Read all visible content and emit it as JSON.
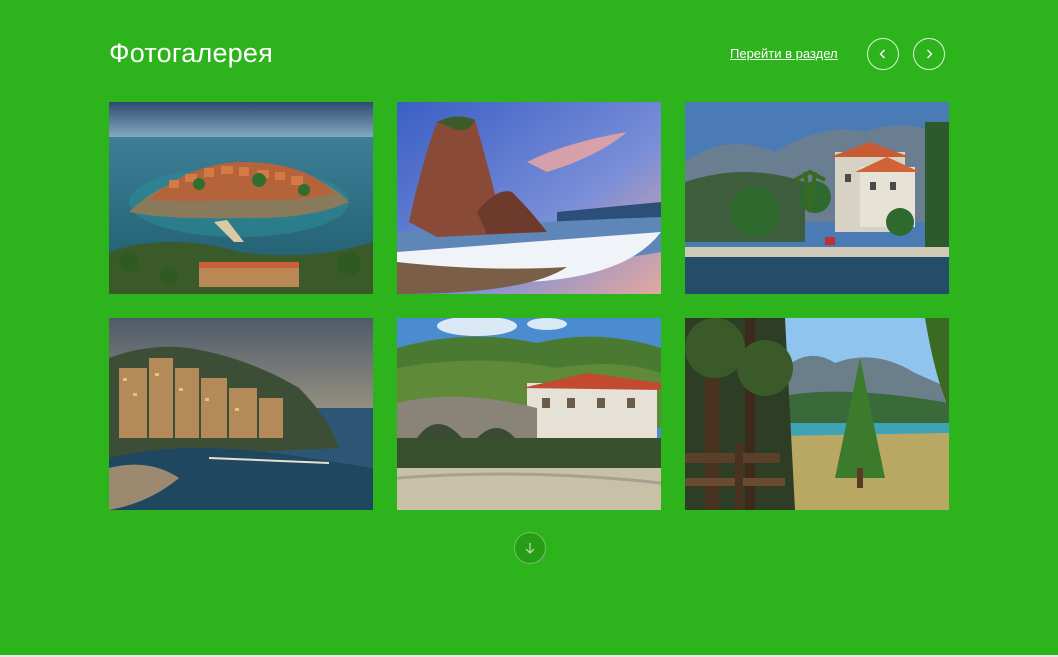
{
  "header": {
    "title": "Фотогалерея",
    "section_link": "Перейти в раздел",
    "prev_icon": "chevron-left-icon",
    "next_icon": "chevron-right-icon"
  },
  "gallery": {
    "photos": [
      {
        "subject": "island-town"
      },
      {
        "subject": "sea-rock-beach"
      },
      {
        "subject": "bay-village"
      },
      {
        "subject": "hillside-resort"
      },
      {
        "subject": "stone-bridge-river"
      },
      {
        "subject": "mountain-lake-forest"
      }
    ]
  },
  "load_more": {
    "icon": "arrow-down-icon"
  },
  "colors": {
    "background": "#2db31b",
    "text": "#ffffff"
  }
}
